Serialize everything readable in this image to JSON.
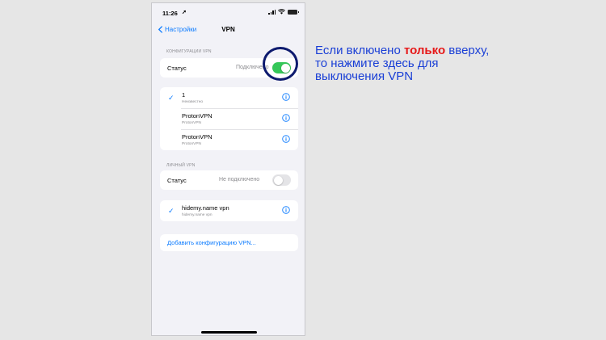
{
  "status_bar": {
    "time": "11:26"
  },
  "nav": {
    "back_label": "Настройки",
    "title": "VPN"
  },
  "vpn_config": {
    "header": "КОНФИГУРАЦИИ VPN",
    "status_label": "Статус",
    "status_value": "Подключено",
    "toggle_on": true,
    "items": [
      {
        "name": "1",
        "sub": "Неизвестно",
        "checked": true
      },
      {
        "name": "ProtonVPN",
        "sub": "ProtonVPN",
        "checked": false
      },
      {
        "name": "ProtonVPN",
        "sub": "ProtonVPN",
        "checked": false
      }
    ]
  },
  "personal_vpn": {
    "header": "ЛИЧНЫЙ VPN",
    "status_label": "Статус",
    "status_value": "Не подключено",
    "toggle_on": false,
    "items": [
      {
        "name": "hidemy.name vpn",
        "sub": "hidemy.name vpn",
        "checked": true
      }
    ]
  },
  "add_config_label": "Добавить конфигурацию VPN...",
  "annotation": {
    "line1_prefix": "Если включено ",
    "line1_highlight": "только",
    "line1_suffix": " вверху,",
    "line2": "то нажмите здесь для",
    "line3": "выключения VPN"
  },
  "colors": {
    "accent": "#0a7aff",
    "toggle_on": "#35c759",
    "annotation": "#1a3fd6",
    "highlight": "#e61919",
    "ring": "#0d1a6e"
  },
  "icons": [
    "location-arrow-icon",
    "signal-icon",
    "wifi-icon",
    "battery-icon",
    "chevron-left-icon",
    "checkmark-icon",
    "info-icon"
  ]
}
